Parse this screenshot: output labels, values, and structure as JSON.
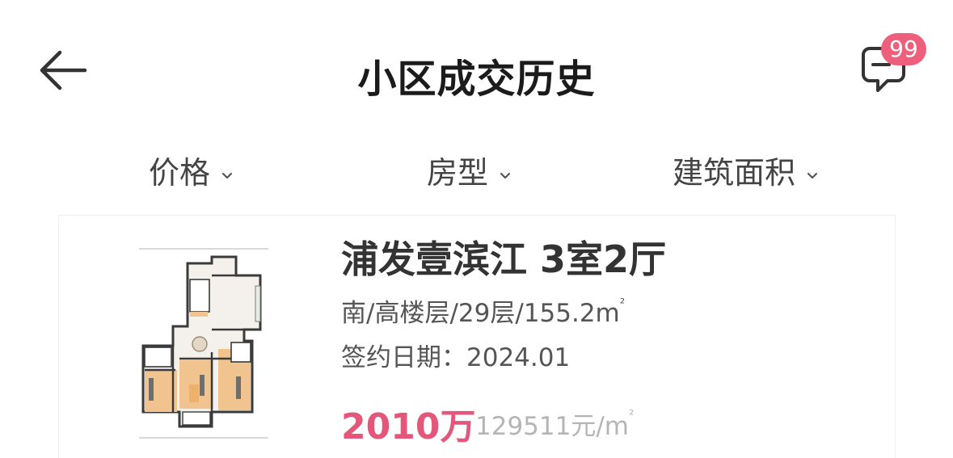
{
  "header": {
    "title": "小区成交历史",
    "badge_count": "99",
    "back_icon": "arrow-left-icon",
    "message_icon": "chat-bubble-icon"
  },
  "filters": [
    {
      "label": "价格",
      "icon": "chevron-down-icon"
    },
    {
      "label": "房型",
      "icon": "chevron-down-icon"
    },
    {
      "label": "建筑面积",
      "icon": "chevron-down-icon"
    }
  ],
  "listing": {
    "title": "浦发壹滨江 3室2厅",
    "orientation": "南",
    "floor_level": "高楼层",
    "total_floors": "29层",
    "area": "155.2m",
    "area_sup": "²",
    "date_label": "签约日期：",
    "date": "2024.01",
    "price": "2010万",
    "unit_price": "129511元/m",
    "unit_price_sup": "²"
  },
  "colors": {
    "accent": "#e2577a",
    "badge": "#ee5f7b",
    "text_primary": "#1b1b1b",
    "text_secondary": "#555555",
    "text_muted": "#b5b5b5"
  }
}
